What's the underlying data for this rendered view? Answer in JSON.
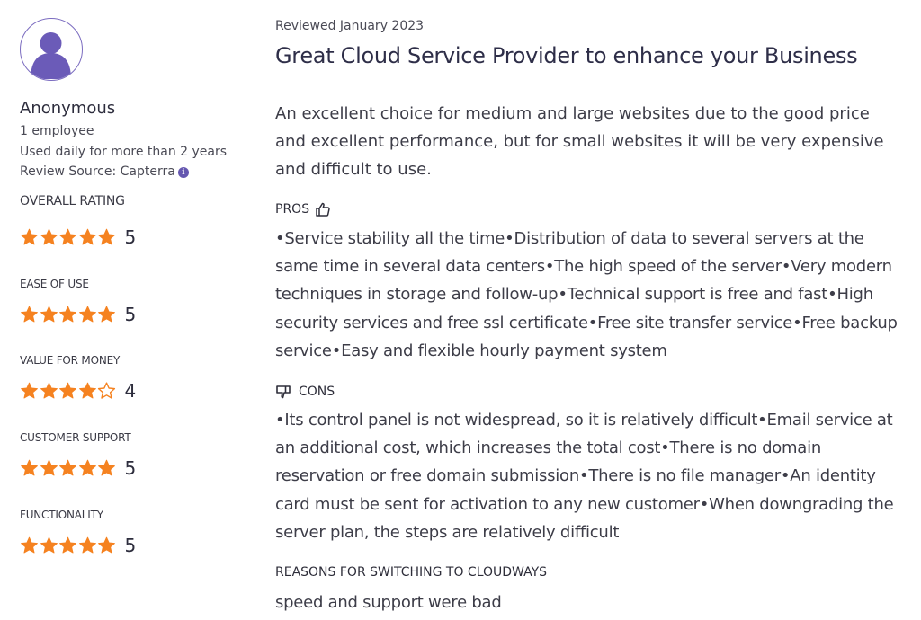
{
  "reviewer": {
    "name": "Anonymous",
    "company_size": "1 employee",
    "usage": "Used daily for more than 2 years",
    "source": "Review Source: Capterra",
    "avatar_color": "#6b5bb8"
  },
  "ratings": [
    {
      "label": "OVERALL RATING",
      "value": "5",
      "stars": 5
    },
    {
      "label": "EASE OF USE",
      "value": "5",
      "stars": 5
    },
    {
      "label": "VALUE FOR MONEY",
      "value": "4",
      "stars": 4
    },
    {
      "label": "CUSTOMER SUPPORT",
      "value": "5",
      "stars": 5
    },
    {
      "label": "FUNCTIONALITY",
      "value": "5",
      "stars": 5
    }
  ],
  "star_color": "#f58220",
  "review": {
    "date": "Reviewed January 2023",
    "title": "Great Cloud Service Provider to enhance your Business",
    "summary": "An excellent choice for medium and large websites due to the good price and excellent performance, but for small websites it will be very expensive and difficult to use.",
    "pros_label": "PROS",
    "pros": "•Service stability all the time•Distribution of data to several servers at the same time in several data centers•The high speed of the server•Very modern techniques in storage and follow-up•Technical support is free and fast•High security services and free ssl certificate•Free site transfer service•Free backup service•Easy and flexible hourly payment system",
    "cons_label": "CONS",
    "cons": "•Its control panel is not widespread, so it is relatively difficult•Email service at an additional cost, which increases the total cost•There is no domain reservation or free domain submission•There is no file manager•An identity card must be sent for activation to any new customer•When downgrading the server plan, the steps are relatively difficult",
    "switch_label": "REASONS FOR SWITCHING TO CLOUDWAYS",
    "switch_reason": "speed and support were bad"
  }
}
